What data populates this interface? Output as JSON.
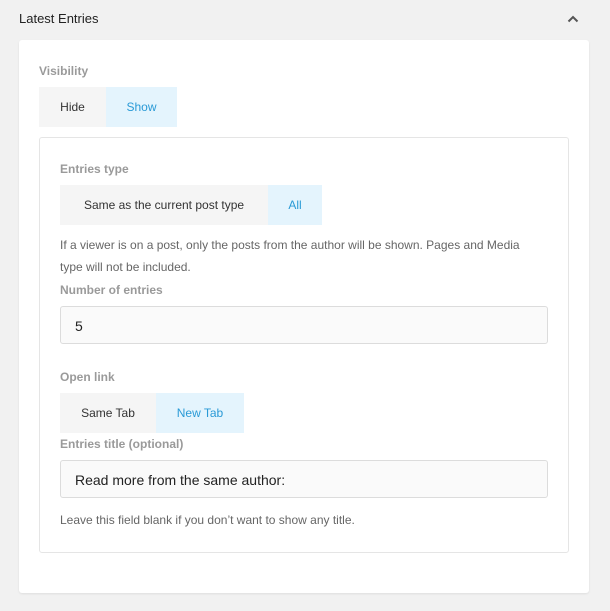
{
  "section": {
    "title": "Latest Entries",
    "collapse_icon": "chevron-up-icon"
  },
  "visibility": {
    "label": "Visibility",
    "options": [
      "Hide",
      "Show"
    ],
    "selected": "Show"
  },
  "entries_type": {
    "label": "Entries type",
    "options": [
      "Same as the current post type",
      "All"
    ],
    "selected": "All",
    "help_line1": "If a viewer is on a post, only the posts from the author will be shown. Pages and Media",
    "help_line2": "type will not be included."
  },
  "number_of_entries": {
    "label": "Number of entries",
    "value": "5"
  },
  "open_link": {
    "label": "Open link",
    "options": [
      "Same Tab",
      "New Tab"
    ],
    "selected": "New Tab"
  },
  "entries_title": {
    "label": "Entries title (optional)",
    "value": "Read more from the same author:",
    "help": "Leave this field blank if you don’t want to show any title."
  },
  "colors": {
    "accent": "#2a9ad6",
    "accent_bg": "#e4f4fd",
    "option_bg": "#f5f5f5",
    "page_bg": "#f1f1f1"
  }
}
